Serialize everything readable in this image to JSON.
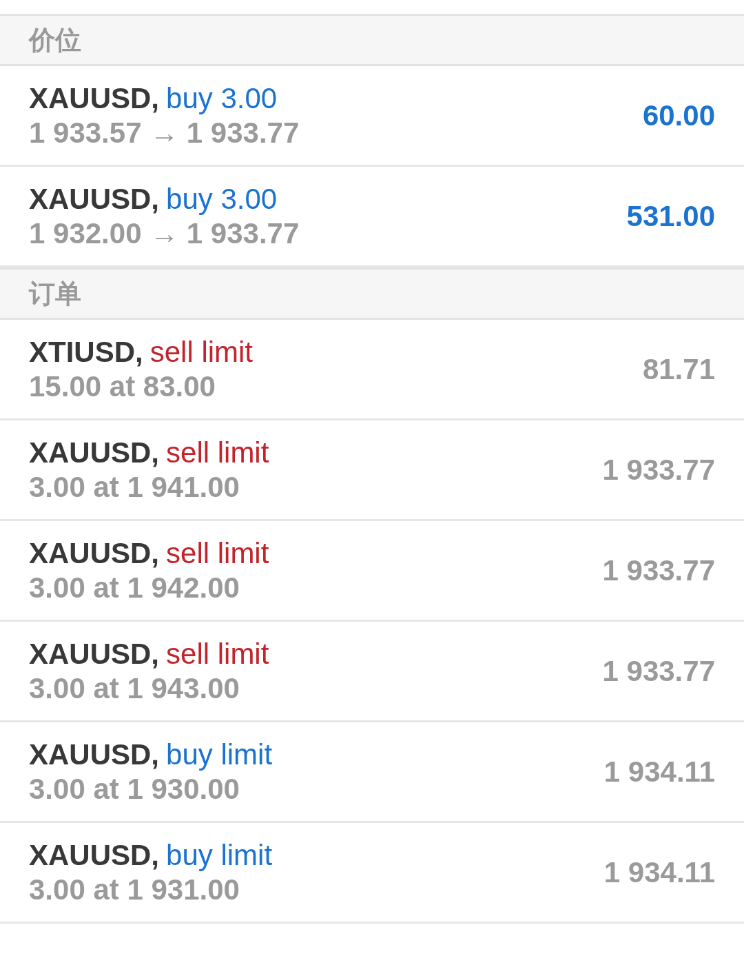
{
  "sections": [
    {
      "title": "价位",
      "items": [
        {
          "kind": "position",
          "symbol": "XAUUSD,",
          "color": "#1a73d0",
          "order": "buy 3.00",
          "detail": "1 933.57 → 1 933.77",
          "value": "60.00"
        },
        {
          "kind": "position",
          "symbol": "XAUUSD,",
          "color": "#1a73d0",
          "order": "buy 3.00",
          "detail": "1 932.00 → 1 933.77",
          "value": "531.00"
        }
      ]
    },
    {
      "title": "订单",
      "items": [
        {
          "kind": "order",
          "symbol": "XTIUSD,",
          "color": "#c3232b",
          "order": "sell limit",
          "detail": "15.00 at 83.00",
          "value": "81.71"
        },
        {
          "kind": "order",
          "symbol": "XAUUSD,",
          "color": "#c3232b",
          "order": "sell limit",
          "detail": "3.00 at 1 941.00",
          "value": "1 933.77"
        },
        {
          "kind": "order",
          "symbol": "XAUUSD,",
          "color": "#c3232b",
          "order": "sell limit",
          "detail": "3.00 at 1 942.00",
          "value": "1 933.77"
        },
        {
          "kind": "order",
          "symbol": "XAUUSD,",
          "color": "#c3232b",
          "order": "sell limit",
          "detail": "3.00 at 1 943.00",
          "value": "1 933.77"
        },
        {
          "kind": "order",
          "symbol": "XAUUSD,",
          "color": "#1a73d0",
          "order": "buy limit",
          "detail": "3.00 at 1 930.00",
          "value": "1 934.11"
        },
        {
          "kind": "order",
          "symbol": "XAUUSD,",
          "color": "#1a73d0",
          "order": "buy limit",
          "detail": "3.00 at 1 931.00",
          "value": "1 934.11"
        }
      ]
    }
  ]
}
